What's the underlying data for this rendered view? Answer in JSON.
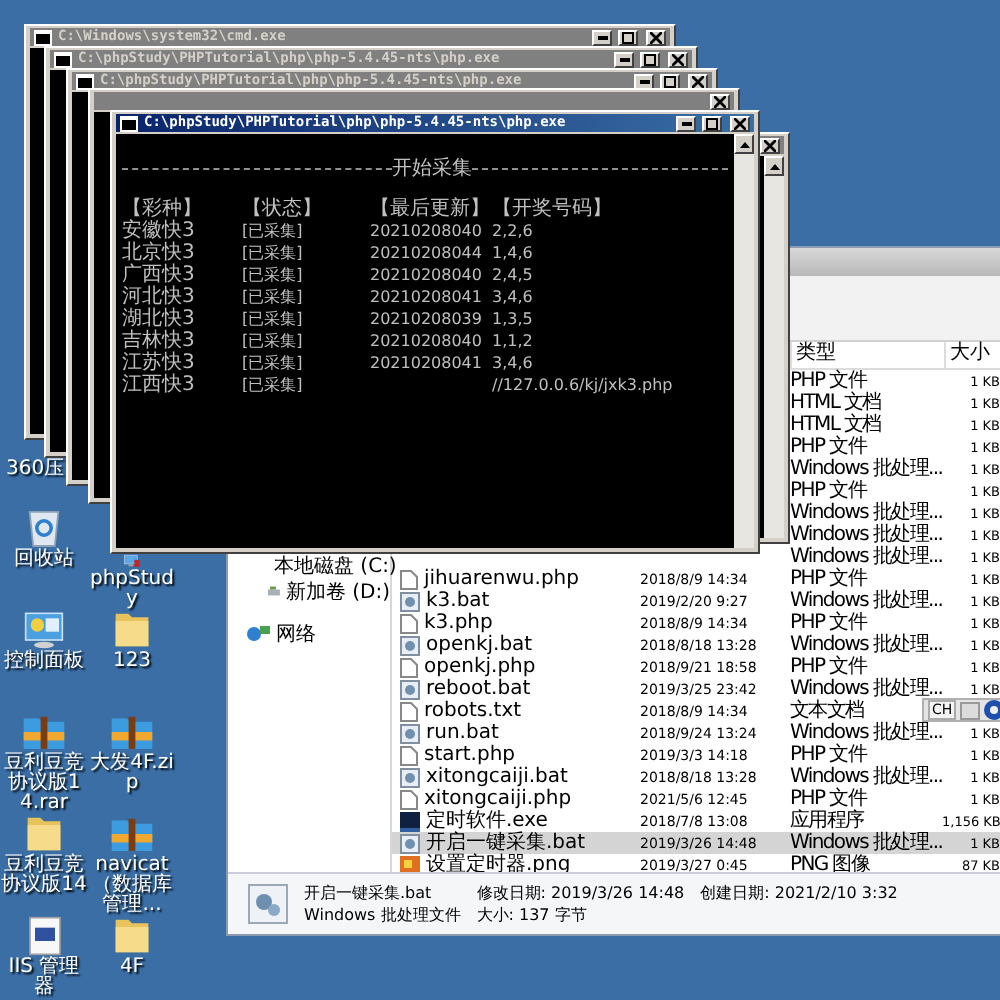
{
  "desktop_icons": [
    [
      {
        "label": "360压"
      },
      {
        "kind": "recycle",
        "label": "回收站"
      },
      {
        "kind": "panel",
        "label": "控制面板"
      },
      {
        "kind": "archive",
        "label": "豆利豆竞协议版14.rar"
      },
      {
        "kind": "folder",
        "label": "豆利豆竞协议版14"
      },
      {
        "kind": "iis",
        "label": "IIS 管理器"
      }
    ],
    [
      {
        "kind": "app",
        "label": "phpStudy"
      },
      {
        "kind": "folder",
        "label": "123"
      },
      {
        "kind": "archive",
        "label": "大发4F.zip"
      },
      {
        "kind": "archive",
        "label": "navicat（数据库管理..."
      },
      {
        "kind": "folder",
        "label": "4F"
      }
    ]
  ],
  "explorer": {
    "header": {
      "type": "类型",
      "size": "大小"
    },
    "nav": [
      {
        "kind": "drive",
        "label": "本地磁盘 (C:)"
      },
      {
        "kind": "drive",
        "label": "新加卷 (D:)"
      },
      {
        "kind": "network",
        "label": "网络"
      }
    ],
    "rows": [
      {
        "type": "PHP 文件",
        "size": "1 KB",
        "selected": false
      },
      {
        "type": "HTML 文档",
        "size": "1 KB",
        "selected": false
      },
      {
        "type": "HTML 文档",
        "size": "1 KB",
        "selected": false
      },
      {
        "type": "PHP 文件",
        "size": "1 KB",
        "selected": false
      },
      {
        "type": "Windows 批处理...",
        "size": "1 KB",
        "selected": false
      },
      {
        "type": "PHP 文件",
        "size": "1 KB",
        "selected": false
      },
      {
        "type": "Windows 批处理...",
        "size": "1 KB",
        "selected": false
      },
      {
        "type": "Windows 批处理...",
        "size": "1 KB",
        "selected": false
      },
      {
        "type": "Windows 批处理...",
        "size": "1 KB",
        "selected": false
      },
      {
        "kind": "php",
        "name": "jihuarenwu.php",
        "date": "2018/8/9 14:34",
        "type": "PHP 文件",
        "size": "1 KB",
        "selected": false
      },
      {
        "kind": "bat",
        "name": "k3.bat",
        "date": "2019/2/20 9:27",
        "type": "Windows 批处理...",
        "size": "1 KB",
        "selected": false
      },
      {
        "kind": "php",
        "name": "k3.php",
        "date": "2018/8/9 14:34",
        "type": "PHP 文件",
        "size": "1 KB",
        "selected": false
      },
      {
        "kind": "bat",
        "name": "openkj.bat",
        "date": "2018/8/18 13:28",
        "type": "Windows 批处理...",
        "size": "1 KB",
        "selected": false
      },
      {
        "kind": "php",
        "name": "openkj.php",
        "date": "2018/9/21 18:58",
        "type": "PHP 文件",
        "size": "1 KB",
        "selected": false
      },
      {
        "kind": "bat",
        "name": "reboot.bat",
        "date": "2019/3/25 23:42",
        "type": "Windows 批处理...",
        "size": "1 KB",
        "selected": false
      },
      {
        "kind": "php",
        "name": "robots.txt",
        "date": "2018/8/9 14:34",
        "type": "文本文档",
        "selected": false
      },
      {
        "kind": "bat",
        "name": "run.bat",
        "date": "2018/9/24 13:24",
        "type": "Windows 批处理...",
        "size": "1 KB",
        "selected": false
      },
      {
        "kind": "php",
        "name": "start.php",
        "date": "2019/3/3 14:18",
        "type": "PHP 文件",
        "size": "1 KB",
        "selected": false
      },
      {
        "kind": "bat",
        "name": "xitongcaiji.bat",
        "date": "2018/8/18 13:28",
        "type": "Windows 批处理...",
        "size": "1 KB",
        "selected": false
      },
      {
        "kind": "php",
        "name": "xitongcaiji.php",
        "date": "2021/5/6 12:45",
        "type": "PHP 文件",
        "size": "1 KB",
        "selected": false
      },
      {
        "kind": "exe",
        "name": "定时软件.exe",
        "date": "2018/7/8 13:08",
        "type": "应用程序",
        "size": "1,156 KB",
        "selected": false
      },
      {
        "kind": "bat",
        "name": "开启一键采集.bat",
        "date": "2019/3/26 14:48",
        "type": "Windows 批处理...",
        "size": "1 KB",
        "selected": true
      },
      {
        "kind": "png",
        "name": "设置定时器.png",
        "date": "2019/3/27 0:45",
        "type": "PNG 图像",
        "size": "87 KB",
        "selected": false
      }
    ],
    "details": {
      "name": "开启一键采集.bat",
      "modified": "修改日期: 2019/3/26 14:48",
      "created": "创建日期: 2021/2/10 3:32",
      "type": "Windows 批处理文件",
      "size": "大小: 137 字节"
    }
  },
  "console_windows": [
    {
      "title": "C:\\Windows\\system32\\cmd.exe",
      "active": false
    },
    {
      "title": "C:\\phpStudy\\PHPTutorial\\php\\php-5.4.45-nts\\php.exe",
      "active": false
    },
    {
      "title": "C:\\phpStudy\\PHPTutorial\\php\\php-5.4.45-nts\\php.exe",
      "active": false
    },
    {
      "active": false
    },
    {
      "active": false
    },
    {
      "title": "C:\\phpStudy\\PHPTutorial\\php\\php-5.4.45-nts\\php.exe",
      "active": true,
      "banner": "开始采集",
      "columns": [
        "【彩种】",
        "【状态】",
        "【最后更新】",
        "【开奖号码】"
      ],
      "rows": [
        [
          "安徽快3",
          "[已采集]",
          "20210208040",
          "2,2,6"
        ],
        [
          "北京快3",
          "[已采集]",
          "20210208044",
          "1,4,6"
        ],
        [
          "广西快3",
          "[已采集]",
          "20210208040",
          "2,4,5"
        ],
        [
          "河北快3",
          "[已采集]",
          "20210208041",
          "3,4,6"
        ],
        [
          "湖北快3",
          "[已采集]",
          "20210208039",
          "1,3,5"
        ],
        [
          "吉林快3",
          "[已采集]",
          "20210208040",
          "1,1,2"
        ],
        [
          "江苏快3",
          "[已采集]",
          "20210208041",
          "3,4,6"
        ],
        [
          "江西快3",
          "[已采集]",
          "",
          "//127.0.0.6/kj/jxk3.php"
        ]
      ]
    }
  ],
  "language_bar": {
    "label": "CH"
  }
}
